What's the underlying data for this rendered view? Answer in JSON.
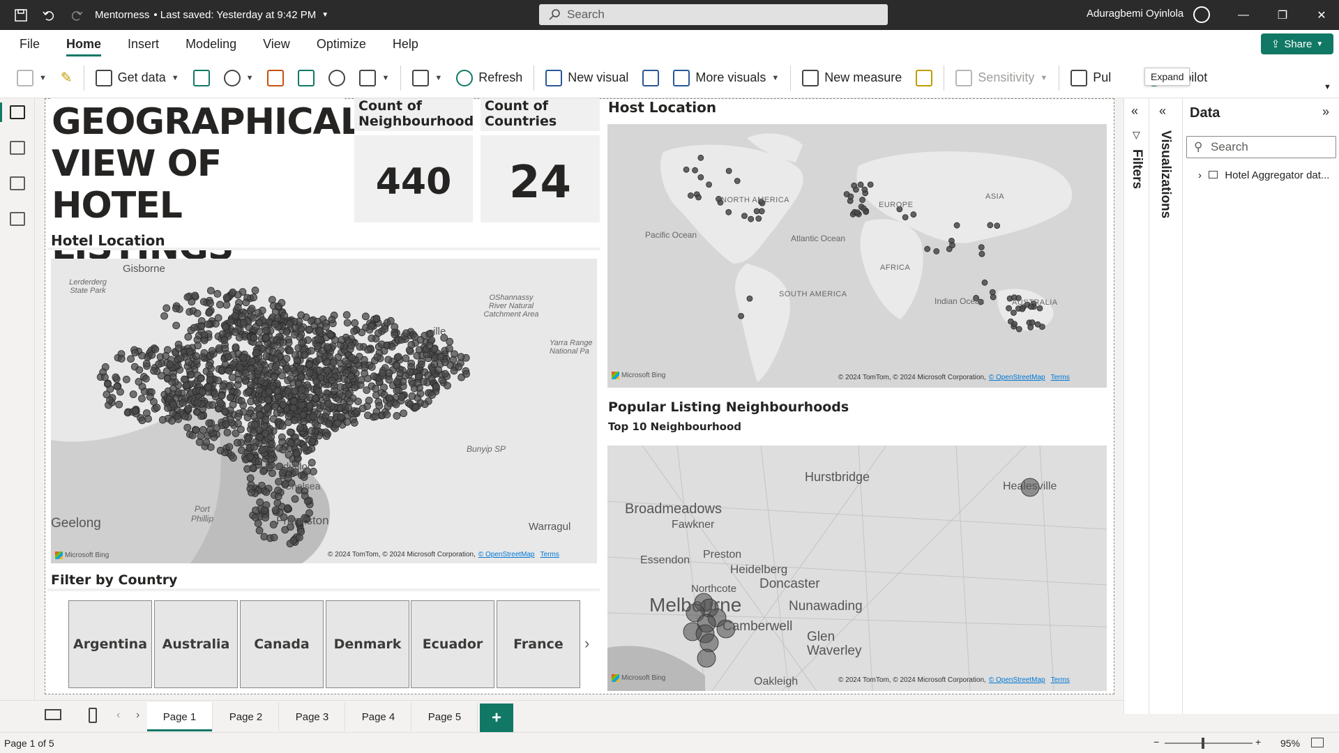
{
  "titlebar": {
    "doc_title": "Mentorness",
    "saved_status": "• Last saved: Yesterday at 9:42 PM",
    "search_placeholder": "Search",
    "user_name": "Aduragbemi Oyinlola"
  },
  "menu": {
    "items": [
      "File",
      "Home",
      "Insert",
      "Modeling",
      "View",
      "Optimize",
      "Help"
    ],
    "active": "Home",
    "share_label": "Share"
  },
  "ribbon": {
    "get_data": "Get data",
    "refresh": "Refresh",
    "new_visual": "New visual",
    "more_visuals": "More visuals",
    "new_measure": "New measure",
    "sensitivity": "Sensitivity",
    "publish": "Pul",
    "copilot": "Copilot",
    "expand_tooltip": "Expand"
  },
  "report": {
    "main_title": "GEOGRAPHICAL VIEW OF HOTEL LISTINGS",
    "cards": [
      {
        "label": "Count of Neighbourhood",
        "value": "440"
      },
      {
        "label": "Count of Countries",
        "value": "24"
      }
    ],
    "hotel_location_title": "Hotel Location",
    "host_location_title": "Host Location",
    "popular_title": "Popular Listing Neighbourhoods",
    "popular_subtitle": "Top 10 Neighbourhood",
    "filter_title": "Filter by Country",
    "countries": [
      "Argentina",
      "Australia",
      "Canada",
      "Denmark",
      "Ecuador",
      "France"
    ]
  },
  "maps": {
    "attribution": "© 2024 TomTom, © 2024 Microsoft Corporation,",
    "osm": "© OpenStreetMap",
    "terms": "Terms",
    "bing": "Microsoft Bing",
    "hotel_labels": [
      "Gisborne",
      "Lerderderg State Park",
      "OShannassy River Natural Catchment Area",
      "Yarra Range National Pa",
      "Mordialloc",
      "Port Phillip",
      "Geelong",
      "Frankston",
      "Warragul",
      "Bunyip SP",
      "Chelsea",
      "ille"
    ],
    "world_labels": [
      "NORTH AMERICA",
      "EUROPE",
      "ASIA",
      "Pacific Ocean",
      "Atlantic Ocean",
      "AFRICA",
      "SOUTH AMERICA",
      "Indian Ocean",
      "AUSTRALIA"
    ],
    "melb_labels": [
      "Hurstbridge",
      "Healesville",
      "Broadmeadows",
      "Fawkner",
      "Preston",
      "Essendon",
      "Heidelberg",
      "Northcote",
      "Doncaster",
      "Melbourne",
      "Nunawading",
      "Camberwell",
      "Glen Waverley",
      "Oakleigh"
    ]
  },
  "panes": {
    "filters": "Filters",
    "visualizations": "Visualizations",
    "data_title": "Data",
    "data_search_placeholder": "Search",
    "data_item": "Hotel Aggregator dat..."
  },
  "pages": {
    "tabs": [
      "Page 1",
      "Page 2",
      "Page 3",
      "Page 4",
      "Page 5"
    ],
    "active": "Page 1"
  },
  "status": {
    "page_info": "Page 1 of 5",
    "zoom": "95%"
  },
  "colors": {
    "accent": "#117865",
    "titlebar": "#2b2b2b",
    "bubble": "#4a4a4a"
  }
}
